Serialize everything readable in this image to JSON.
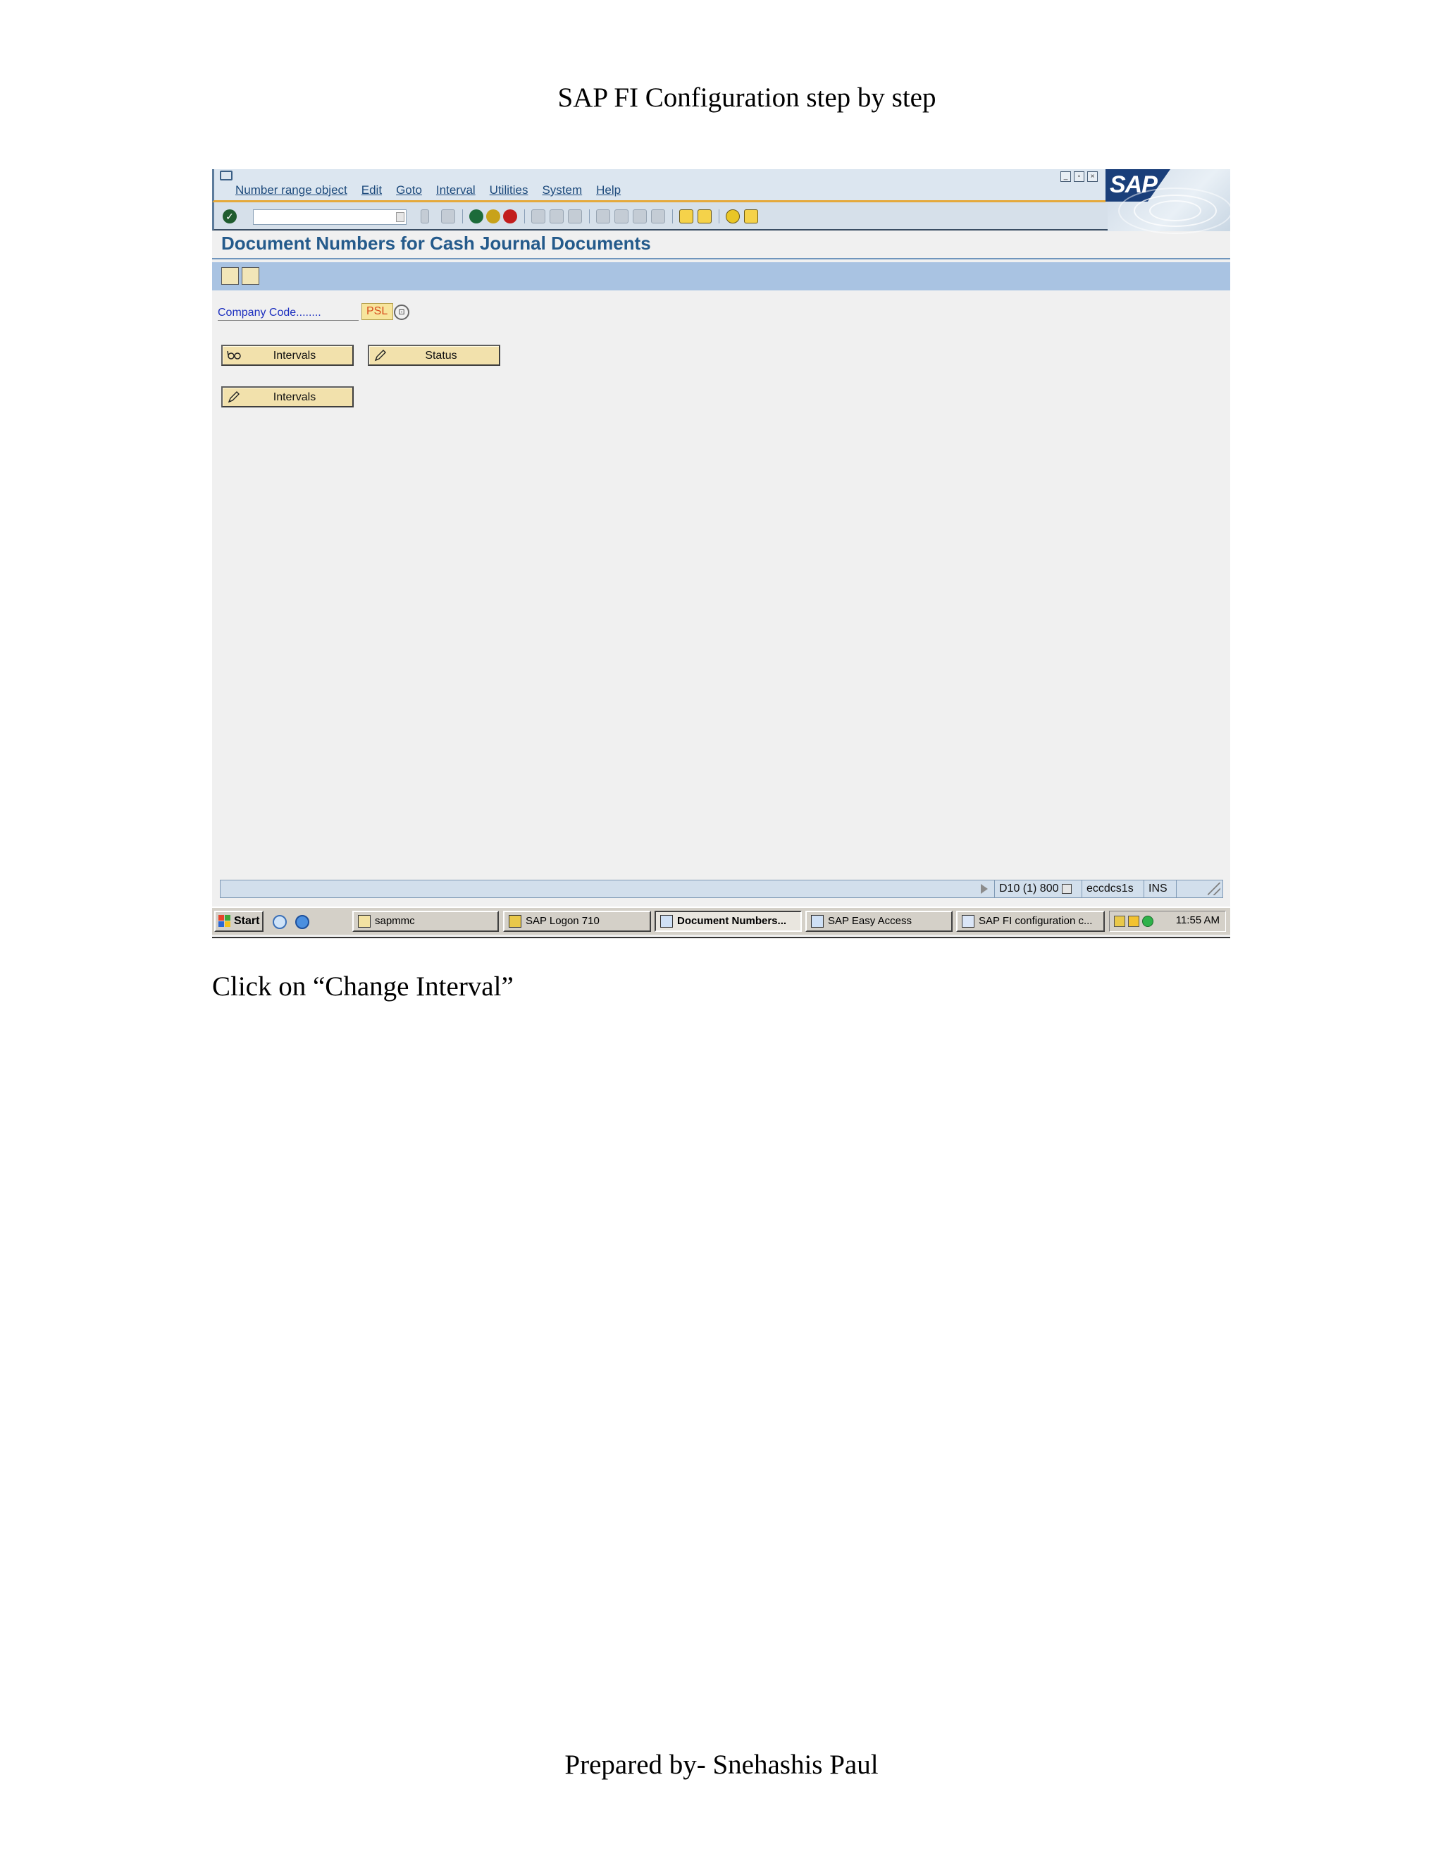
{
  "document": {
    "header": "SAP FI Configuration step by step",
    "instruction": "Click on “Change Interval”",
    "footer": "Prepared by- Snehashis Paul"
  },
  "sap_window": {
    "menu": [
      "Number range object",
      "Edit",
      "Goto",
      "Interval",
      "Utilities",
      "System",
      "Help"
    ],
    "logo_text": "SAP",
    "command_field": {
      "value": ""
    },
    "title": "Document Numbers for Cash Journal Documents",
    "company_code": {
      "label": "Company Code........",
      "value": "PSL"
    },
    "buttons": {
      "display_intervals": "Intervals",
      "status": "Status",
      "change_intervals": "Intervals"
    },
    "status_bar": {
      "system": "D10 (1) 800",
      "server": "eccdcs1s",
      "mode": "INS"
    },
    "colors": {
      "title": "#245a8b",
      "app_toolbar": "#a9c3e2",
      "button_face": "#f2e1ac",
      "field_required": "#f7e59c"
    }
  },
  "taskbar": {
    "start_label": "Start",
    "tasks": [
      "sapmmc",
      "SAP Logon 710",
      "Document Numbers...",
      "SAP Easy Access",
      "SAP FI configuration c..."
    ],
    "active_task": "Document Numbers...",
    "clock": "11:55 AM"
  }
}
